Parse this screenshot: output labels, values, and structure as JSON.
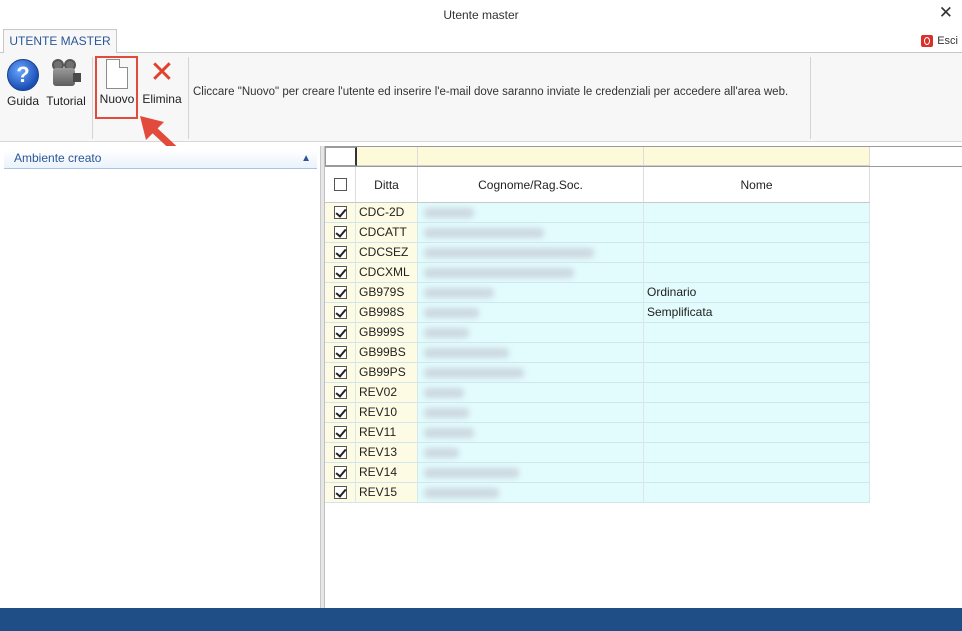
{
  "window": {
    "title": "Utente master",
    "close_glyph": "✕"
  },
  "tabs": {
    "active_label": "UTENTE MASTER",
    "exit_label": "Esci"
  },
  "ribbon": {
    "buttons": {
      "guida": "Guida",
      "tutorial": "Tutorial",
      "nuovo": "Nuovo",
      "elimina": "Elimina"
    },
    "hint": "Cliccare \"Nuovo\" per creare l'utente ed inserire l'e-mail dove saranno inviate le credenziali per accedere all'area web."
  },
  "left_panel": {
    "header": "Ambiente creato",
    "collapse_glyph": "▲"
  },
  "grid": {
    "columns": [
      "Ditta",
      "Cognome/Rag.Soc.",
      "Nome"
    ],
    "rows": [
      {
        "ditta": "CDC-2D",
        "cognome": "",
        "nome": "",
        "checked": true
      },
      {
        "ditta": "CDCATT",
        "cognome": "",
        "nome": "",
        "checked": true
      },
      {
        "ditta": "CDCSEZ",
        "cognome": "",
        "nome": "",
        "checked": true
      },
      {
        "ditta": "CDCXML",
        "cognome": "",
        "nome": "",
        "checked": true
      },
      {
        "ditta": "GB979S",
        "cognome": "",
        "nome": "Ordinario",
        "checked": true
      },
      {
        "ditta": "GB998S",
        "cognome": "",
        "nome": "Semplificata",
        "checked": true
      },
      {
        "ditta": "GB999S",
        "cognome": "",
        "nome": "",
        "checked": true
      },
      {
        "ditta": "GB99BS",
        "cognome": "",
        "nome": "",
        "checked": true
      },
      {
        "ditta": "GB99PS",
        "cognome": "",
        "nome": "",
        "checked": true
      },
      {
        "ditta": "REV02",
        "cognome": "",
        "nome": "",
        "checked": true
      },
      {
        "ditta": "REV10",
        "cognome": "",
        "nome": "",
        "checked": true
      },
      {
        "ditta": "REV11",
        "cognome": "",
        "nome": "",
        "checked": true
      },
      {
        "ditta": "REV13",
        "cognome": "",
        "nome": "",
        "checked": true
      },
      {
        "ditta": "REV14",
        "cognome": "",
        "nome": "",
        "checked": true
      },
      {
        "ditta": "REV15",
        "cognome": "",
        "nome": "",
        "checked": true
      }
    ]
  },
  "colors": {
    "accent_blue": "#2b5797",
    "highlight_red": "#e24b3b",
    "row_cyan": "#e2fbfc",
    "row_yellow": "#fdfbe3",
    "statusbar": "#1f4e86"
  }
}
